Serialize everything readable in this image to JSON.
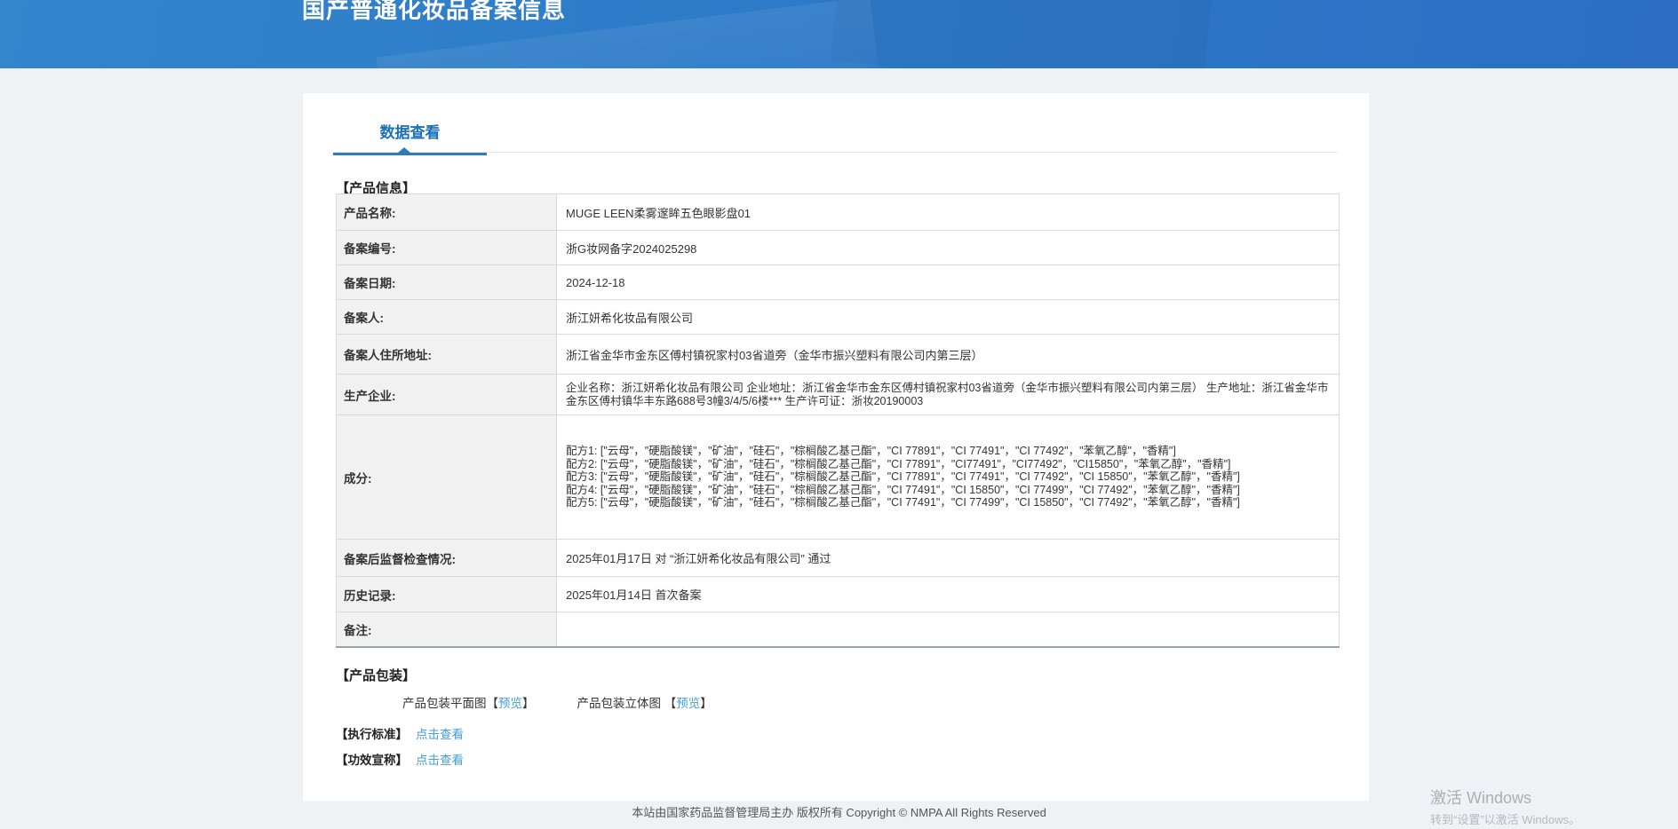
{
  "page": {
    "title": "国产普通化妆品备案信息",
    "tab": "数据查看"
  },
  "product_info": {
    "section_title": "【产品信息】",
    "rows": [
      {
        "label": "产品名称:",
        "value": "MUGE LEEN柔雾邃眸五色眼影盘01"
      },
      {
        "label": "备案编号:",
        "value": "浙G妆网备字2024025298"
      },
      {
        "label": "备案日期:",
        "value": "2024-12-18"
      },
      {
        "label": "备案人:",
        "value": "浙江妍希化妆品有限公司"
      },
      {
        "label": "备案人住所地址:",
        "value": "浙江省金华市金东区傅村镇祝家村03省道旁（金华市振兴塑料有限公司内第三层）"
      },
      {
        "label": "生产企业:",
        "value": "企业名称：浙江妍希化妆品有限公司 企业地址：浙江省金华市金东区傅村镇祝家村03省道旁（金华市振兴塑料有限公司内第三层） 生产地址：浙江省金华市金东区傅村镇华丰东路688号3幢3/4/5/6楼*** 生产许可证：浙妆20190003"
      },
      {
        "label": "成分:",
        "value": "配方1: [\"云母\"，\"硬脂酸镁\"，\"矿油\"，\"硅石\"，\"棕榈酸乙基己酯\"，\"CI 77891\"，\"CI 77491\"，\"CI 77492\"，\"苯氧乙醇\"，\"香精\"]\n配方2: [\"云母\"，\"硬脂酸镁\"，\"矿油\"，\"硅石\"，\"棕榈酸乙基己酯\"，\"CI 77891\"，\"CI77491\"，\"CI77492\"，\"CI15850\"，\"苯氧乙醇\"，\"香精\"]\n配方3: [\"云母\"，\"硬脂酸镁\"，\"矿油\"，\"硅石\"，\"棕榈酸乙基己酯\"，\"CI 77891\"，\"CI 77491\"，\"CI 77492\"，\"CI 15850\"，\"苯氧乙醇\"，\"香精\"]\n配方4: [\"云母\"，\"硬脂酸镁\"，\"矿油\"，\"硅石\"，\"棕榈酸乙基己酯\"，\"CI 77491\"，\"CI 15850\"，\"CI 77499\"，\"CI 77492\"，\"苯氧乙醇\"，\"香精\"]\n配方5: [\"云母\"，\"硬脂酸镁\"，\"矿油\"，\"硅石\"，\"棕榈酸乙基己酯\"，\"CI 77491\"，\"CI 77499\"，\"CI 15850\"，\"CI 77492\"，\"苯氧乙醇\"，\"香精\"]"
      },
      {
        "label": "备案后监督检查情况:",
        "value": "2025年01月17日 对 “浙江妍希化妆品有限公司” 通过"
      },
      {
        "label": "历史记录:",
        "value": "2025年01月14日 首次备案"
      },
      {
        "label": "备注:",
        "value": ""
      }
    ]
  },
  "packaging": {
    "section_title": "【产品包装】",
    "bracket_open": "【",
    "bracket_close": "】",
    "items": [
      {
        "label": "产品包装平面图",
        "link": "预览"
      },
      {
        "label": "产品包装立体图 ",
        "link": "预览"
      }
    ]
  },
  "links": [
    {
      "label": "【执行标准】",
      "link": "点击查看"
    },
    {
      "label": "【功效宣称】",
      "link": "点击查看"
    }
  ],
  "footer": {
    "text": "本站由国家药品监督管理局主办 版权所有 Copyright © NMPA All Rights Reserved"
  },
  "watermark": {
    "line1": "激活 Windows",
    "line2": "转到“设置”以激活 Windows。"
  },
  "colors": {
    "banner_blue_start": "#3385cc",
    "banner_blue_end": "#2b6ec4",
    "tab_blue": "#1c70b8",
    "tab_underline": "#2e7cb7",
    "link_blue": "#459ddb",
    "table_label_bg": "#f1f1f1",
    "table_border": "#d9d9d9",
    "page_bg": "#eef2f5"
  }
}
